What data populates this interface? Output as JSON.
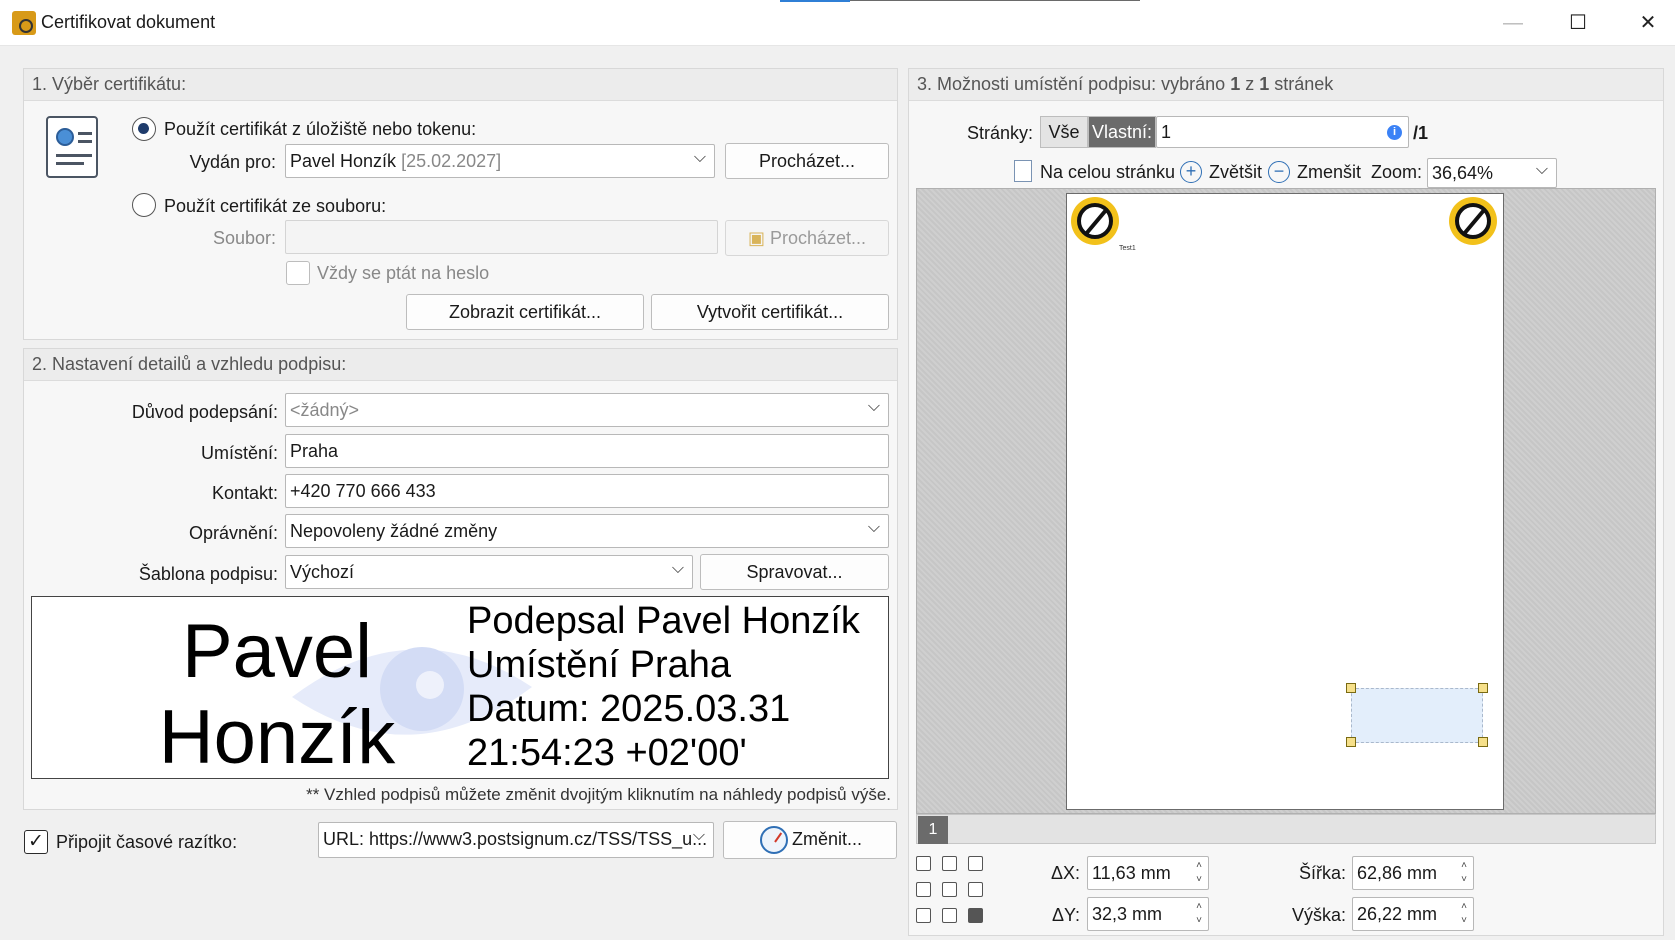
{
  "window": {
    "title": "Certifikovat dokument",
    "minimize_glyph": "—",
    "maximize_glyph": "☐",
    "close_glyph": "✕"
  },
  "cert_section": {
    "heading": "1. Výběr certifikátu:",
    "use_store_label": "Použít certifikát z úložiště nebo tokenu:",
    "issued_for_label": "Vydán pro:",
    "issued_for_value": "Pavel Honzík",
    "issued_for_date": "[25.02.2027]",
    "browse_label": "Procházet...",
    "use_file_label": "Použít certifikát ze souboru:",
    "file_label": "Soubor:",
    "file_value": "",
    "file_browse_label": "Procházet...",
    "always_ask_label": "Vždy se ptát na heslo",
    "show_cert_label": "Zobrazit certifikát...",
    "create_cert_label": "Vytvořit certifikát..."
  },
  "details_section": {
    "heading": "2. Nastavení detailů a vzhledu podpisu:",
    "reason_label": "Důvod podepsání:",
    "reason_value": "<žádný>",
    "location_label": "Umístění:",
    "location_value": "Praha",
    "contact_label": "Kontakt:",
    "contact_value": "+420 770 666 433",
    "permission_label": "Oprávnění:",
    "permission_value": "Nepovoleny žádné změny",
    "template_label": "Šablona podpisu:",
    "template_value": "Výchozí",
    "manage_label": "Spravovat...",
    "preview": {
      "name_line1": "Pavel",
      "name_line2": "Honzík",
      "line1": "Podepsal Pavel Honzík",
      "line2": "Umístění Praha",
      "line3": "Datum: 2025.03.31",
      "line4": "21:54:23 +02'00'"
    },
    "hint": "** Vzhled podpisů můžete změnit dvojitým kliknutím na náhledy podpisů výše."
  },
  "timestamp": {
    "checked": true,
    "label": "Připojit časové razítko:",
    "url_value": "URL: https://www3.postsignum.cz/TSS/TSS_u...",
    "change_label": "Změnit..."
  },
  "placement_section": {
    "heading_prefix": "3. Možnosti umístění podpisu: vybráno",
    "selected_count": "1",
    "heading_mid": "z",
    "total_count": "1",
    "heading_suffix": "stránek",
    "pages_label": "Stránky:",
    "all_label": "Vše",
    "custom_label": "Vlastní:",
    "pages_value": "1",
    "pages_total": "/1",
    "fit_page_label": "Na celou stránku",
    "zoom_in_label": "Zvětšit",
    "zoom_out_label": "Zmenšit",
    "zoom_label": "Zoom:",
    "zoom_value": "36,64%",
    "page_text": "Test1",
    "page_number": "1",
    "dx_label": "ΔX:",
    "dx_value": "11,63 mm",
    "dy_label": "ΔY:",
    "dy_value": "32,3 mm",
    "width_label": "Šířka:",
    "width_value": "62,86 mm",
    "height_label": "Výška:",
    "height_value": "26,22 mm"
  }
}
